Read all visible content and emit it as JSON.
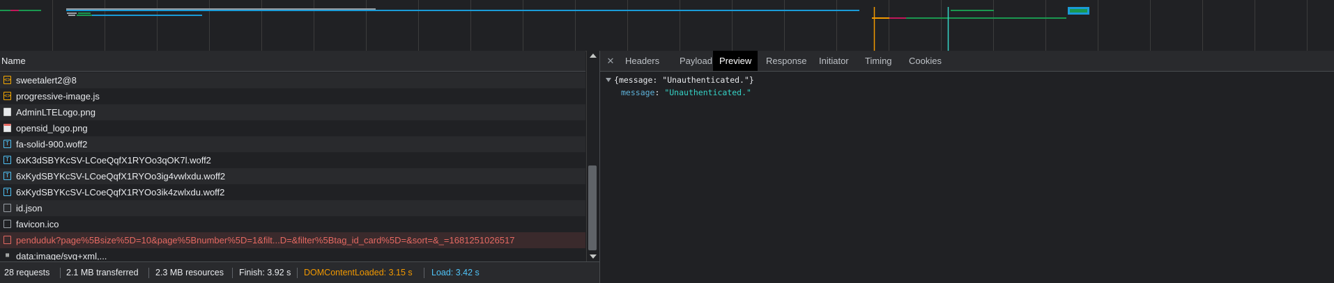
{
  "colors": {
    "bg": "#202124",
    "row_alt": "#292a2d",
    "error": "#e46962",
    "dom_content_loaded": "#f29900",
    "load": "#4fc3f7",
    "json_key": "#5db0d7",
    "json_string": "#35d4c7"
  },
  "request_list": {
    "column_name": "Name",
    "rows": [
      {
        "name": "sweetalert2@8",
        "icon": "script-file-icon"
      },
      {
        "name": "progressive-image.js",
        "icon": "script-file-icon"
      },
      {
        "name": "AdminLTELogo.png",
        "icon": "image-file-icon"
      },
      {
        "name": "opensid_logo.png",
        "icon": "image-file-icon"
      },
      {
        "name": "fa-solid-900.woff2",
        "icon": "font-file-icon"
      },
      {
        "name": "6xK3dSBYKcSV-LCoeQqfX1RYOo3qOK7l.woff2",
        "icon": "font-file-icon"
      },
      {
        "name": "6xKydSBYKcSV-LCoeQqfX1RYOo3ig4vwlxdu.woff2",
        "icon": "font-file-icon"
      },
      {
        "name": "6xKydSBYKcSV-LCoeQqfX1RYOo3ik4zwlxdu.woff2",
        "icon": "font-file-icon"
      },
      {
        "name": "id.json",
        "icon": "document-file-icon"
      },
      {
        "name": "favicon.ico",
        "icon": "document-file-icon"
      },
      {
        "name": "penduduk?page%5Bsize%5D=10&page%5Bnumber%5D=1&filt...D=&filter%5Btag_id_card%5D=&sort=&_=1681251026517",
        "icon": "document-file-icon",
        "error": true
      },
      {
        "name": "data:image/svg+xml,...",
        "icon": "svg-data-icon"
      }
    ]
  },
  "status_bar": {
    "requests": "28 requests",
    "transferred": "2.1 MB transferred",
    "resources": "2.3 MB resources",
    "finish": "Finish: 3.92 s",
    "dom_content_loaded": "DOMContentLoaded: 3.15 s",
    "load": "Load: 3.42 s"
  },
  "details": {
    "tabs": [
      "Headers",
      "Payload",
      "Preview",
      "Response",
      "Initiator",
      "Timing",
      "Cookies"
    ],
    "active_tab": "Preview",
    "preview": {
      "summary_open": "{",
      "summary_key": "message",
      "summary_sep": ": ",
      "summary_value": "\"Unauthenticated.\"",
      "summary_close": "}",
      "key": "message",
      "sep": ": ",
      "value": "\"Unauthenticated.\""
    }
  }
}
